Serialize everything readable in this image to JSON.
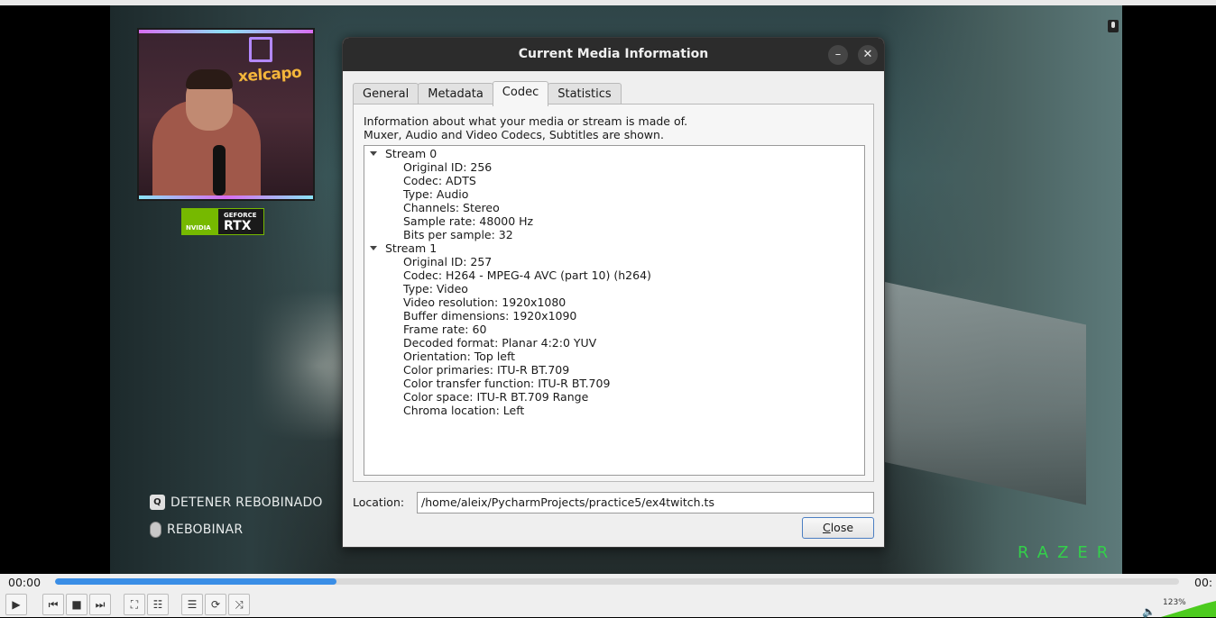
{
  "video": {
    "overlay_hints": [
      {
        "key": "Q",
        "label": "DETENER REBOBINADO"
      },
      {
        "key": "",
        "label": "REBOBINAR"
      }
    ],
    "webcam_logo_text": "xelcapo",
    "nvidia_badge": {
      "brand": "NVIDIA",
      "line1": "GEFORCE",
      "line2": "RTX"
    },
    "razer_watermark": "RAZER"
  },
  "dialog": {
    "title": "Current Media Information",
    "minimize_label": "–",
    "close_icon_label": "✕",
    "tabs": [
      {
        "label": "General",
        "active": false
      },
      {
        "label": "Metadata",
        "active": false
      },
      {
        "label": "Codec",
        "active": true
      },
      {
        "label": "Statistics",
        "active": false
      }
    ],
    "description_line1": "Information about what your media or stream is made of.",
    "description_line2": "Muxer, Audio and Video Codecs, Subtitles are shown.",
    "streams": [
      {
        "name": "Stream 0",
        "expanded": true,
        "properties": [
          "Original ID: 256",
          "Codec: ADTS",
          "Type: Audio",
          "Channels: Stereo",
          "Sample rate: 48000 Hz",
          "Bits per sample: 32"
        ]
      },
      {
        "name": "Stream 1",
        "expanded": true,
        "properties": [
          "Original ID: 257",
          "Codec: H264 - MPEG-4 AVC (part 10) (h264)",
          "Type: Video",
          "Video resolution: 1920x1080",
          "Buffer dimensions: 1920x1090",
          "Frame rate: 60",
          "Decoded format: Planar 4:2:0 YUV",
          "Orientation: Top left",
          "Color primaries: ITU-R BT.709",
          "Color transfer function: ITU-R BT.709",
          "Color space: ITU-R BT.709 Range",
          "Chroma location: Left"
        ]
      }
    ],
    "location_label": "Location:",
    "location_value": "/home/aleix/PycharmProjects/practice5/ex4twitch.ts",
    "close_button_label": "Close"
  },
  "player": {
    "time_elapsed": "00:00",
    "time_total": "00:",
    "progress_fraction": 0.25,
    "volume_label": "123%",
    "buttons": [
      {
        "name": "play-button",
        "icon": "play-icon",
        "glyph": "▶"
      },
      {
        "name": "previous-button",
        "icon": "skip-back-icon",
        "glyph": "⏮"
      },
      {
        "name": "stop-button",
        "icon": "stop-icon",
        "glyph": "■"
      },
      {
        "name": "next-button",
        "icon": "skip-forward-icon",
        "glyph": "⏭"
      },
      {
        "name": "fullscreen-button",
        "icon": "fullscreen-icon",
        "glyph": "⛶"
      },
      {
        "name": "extended-settings-button",
        "icon": "equalizer-icon",
        "glyph": "☷"
      },
      {
        "name": "playlist-button",
        "icon": "playlist-icon",
        "glyph": "☰"
      },
      {
        "name": "loop-button",
        "icon": "loop-icon",
        "glyph": "⟳"
      },
      {
        "name": "shuffle-button",
        "icon": "shuffle-icon",
        "glyph": "⤨"
      }
    ]
  },
  "colors": {
    "accent": "#3a8ee6",
    "titlebar": "#2c2c2c",
    "razer_green": "#33d04a",
    "nvidia_green": "#76b900"
  }
}
